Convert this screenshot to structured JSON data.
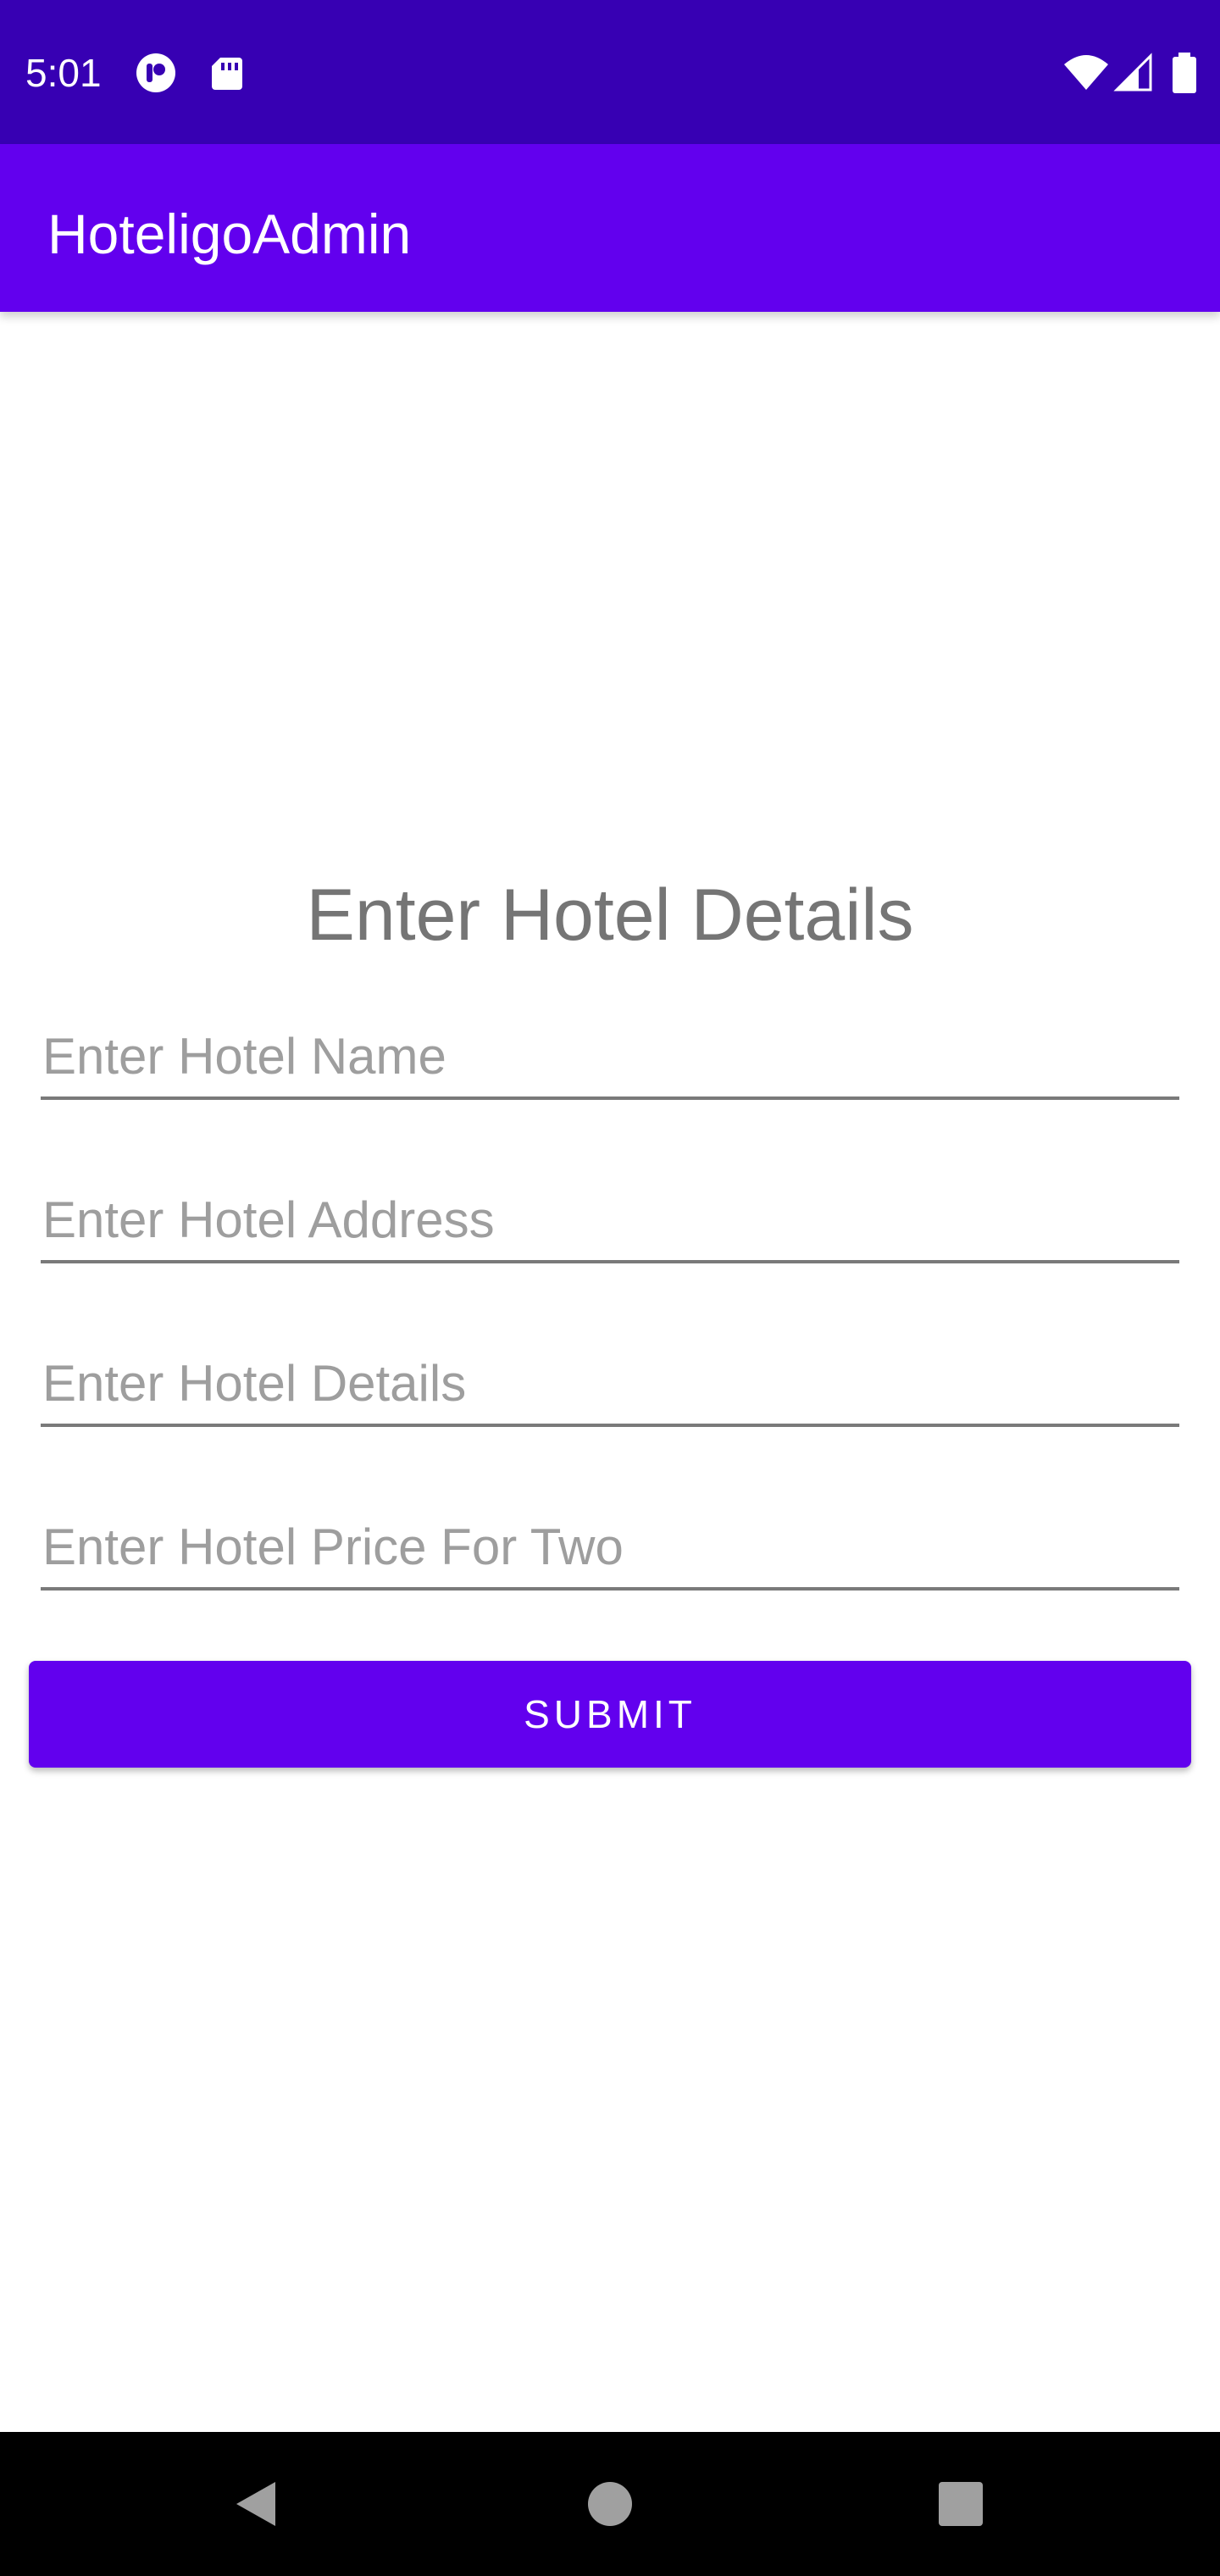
{
  "status_bar": {
    "time": "5:01",
    "icons": [
      "podcast-icon",
      "sd-card-icon",
      "wifi-icon",
      "signal-icon",
      "battery-icon"
    ],
    "color": "#3700b3"
  },
  "app_bar": {
    "title": "HoteligoAdmin",
    "color": "#6200ee"
  },
  "form": {
    "heading": "Enter Hotel Details",
    "fields": [
      {
        "placeholder": "Enter Hotel Name",
        "value": ""
      },
      {
        "placeholder": "Enter Hotel Address",
        "value": ""
      },
      {
        "placeholder": "Enter Hotel Details",
        "value": ""
      },
      {
        "placeholder": "Enter Hotel Price For Two",
        "value": ""
      }
    ],
    "submit_label": "SUBMIT",
    "accent_color": "#6200ee"
  },
  "nav_bar": {
    "buttons": [
      "back-icon",
      "home-icon",
      "recents-icon"
    ]
  }
}
